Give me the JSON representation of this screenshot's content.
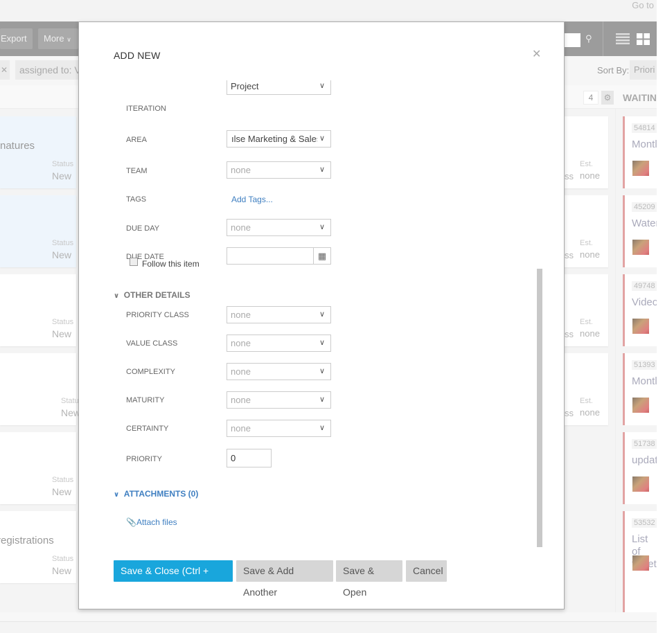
{
  "background": {
    "goto_label": "Go to",
    "toolbar": {
      "export": "Export",
      "more": "More"
    },
    "filter": {
      "assigned": "assigned to: Ve",
      "sort_label": "Sort By:",
      "sort_value": "Priori"
    },
    "column_count": "4",
    "waiting_header": "WAITIN",
    "left_cards": [
      {
        "title": "natures",
        "status_label": "Status",
        "status": "New",
        "selected": true
      },
      {
        "title": "",
        "status_label": "Status",
        "status": "New",
        "selected": true
      },
      {
        "title": "",
        "status_label": "Status",
        "status": "New",
        "selected": false
      },
      {
        "title": "",
        "status_label": "Statu",
        "status": "New",
        "selected": false
      },
      {
        "title": "",
        "status_label": "Status",
        "status": "New",
        "selected": false
      },
      {
        "title": "registrations",
        "status_label": "Status",
        "status": "New",
        "selected": false
      }
    ],
    "mid_cards": [
      {
        "frag": "ss",
        "est_label": "Est.",
        "est": "none"
      },
      {
        "frag": "ss",
        "est_label": "Est.",
        "est": "none"
      },
      {
        "frag": "ss",
        "est_label": "Est.",
        "est": "none"
      },
      {
        "frag": "ss",
        "est_label": "Est.",
        "est": "none"
      }
    ],
    "right_cards": [
      {
        "id": "54814",
        "title": "Montl"
      },
      {
        "id": "45209",
        "title": "Water"
      },
      {
        "id": "49748",
        "title": "Video"
      },
      {
        "id": "51393",
        "title": "Montl"
      },
      {
        "id": "51738",
        "title": "updat"
      },
      {
        "id": "53532",
        "title": "List of tweet"
      }
    ]
  },
  "modal": {
    "title": "ADD NEW",
    "fields": [
      {
        "label": "ITERATION",
        "value": "Project",
        "type": "select",
        "dark": true
      },
      {
        "label": "AREA",
        "value": "ılse Marketing & Sales",
        "type": "select",
        "dark": true
      },
      {
        "label": "TEAM",
        "value": "none",
        "type": "select"
      },
      {
        "label": "TAGS",
        "value": "Add Tags...",
        "type": "link"
      },
      {
        "label": "DUE DAY",
        "value": "none",
        "type": "select"
      },
      {
        "label": "DUE DATE",
        "value": "",
        "type": "date"
      }
    ],
    "follow_label": "Follow this item",
    "follow_checked": false,
    "other_details": "OTHER DETAILS",
    "other_fields": [
      {
        "label": "PRIORITY CLASS",
        "value": "none"
      },
      {
        "label": "VALUE CLASS",
        "value": "none"
      },
      {
        "label": "COMPLEXITY",
        "value": "none"
      },
      {
        "label": "MATURITY",
        "value": "none"
      },
      {
        "label": "CERTAINTY",
        "value": "none"
      }
    ],
    "priority_label": "PRIORITY",
    "priority_value": "0",
    "attachments": "ATTACHMENTS (0)",
    "attach_files": "Attach files",
    "buttons": {
      "save_close": "Save & Close (Ctrl + Enter)",
      "save_add": "Save & Add Another",
      "save_open": "Save & Open",
      "cancel": "Cancel"
    }
  }
}
